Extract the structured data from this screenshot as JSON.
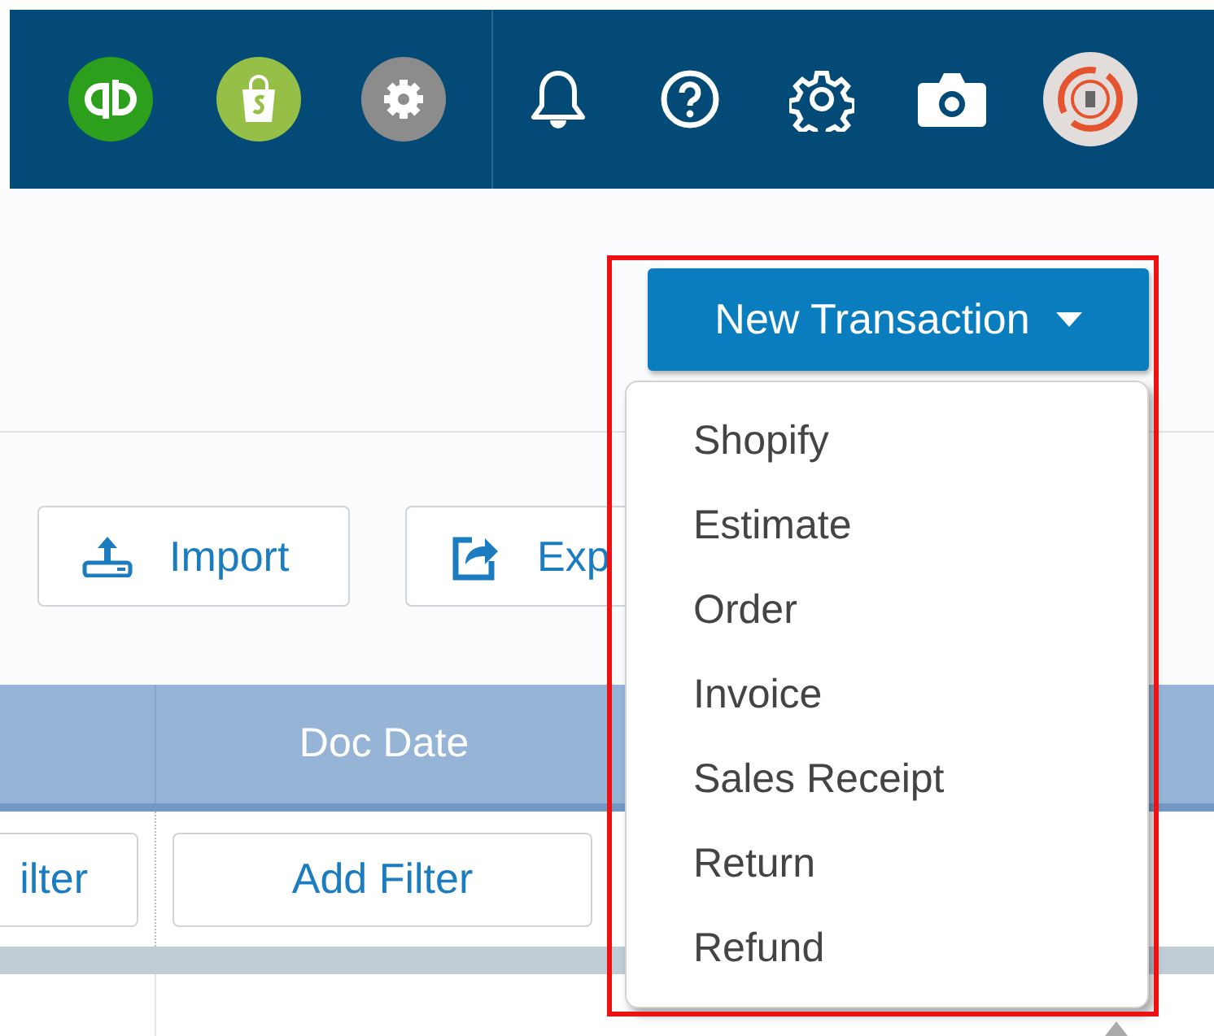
{
  "new_transaction": {
    "label": "New Transaction",
    "expanded": true,
    "items": [
      "Shopify",
      "Estimate",
      "Order",
      "Invoice",
      "Sales Receipt",
      "Return",
      "Refund"
    ]
  },
  "toolbar": {
    "buttons": [
      "Import",
      "Exp"
    ]
  },
  "table": {
    "columns": [
      "Doc Date"
    ],
    "filters": [
      "ilter",
      "Add Filter"
    ]
  }
}
